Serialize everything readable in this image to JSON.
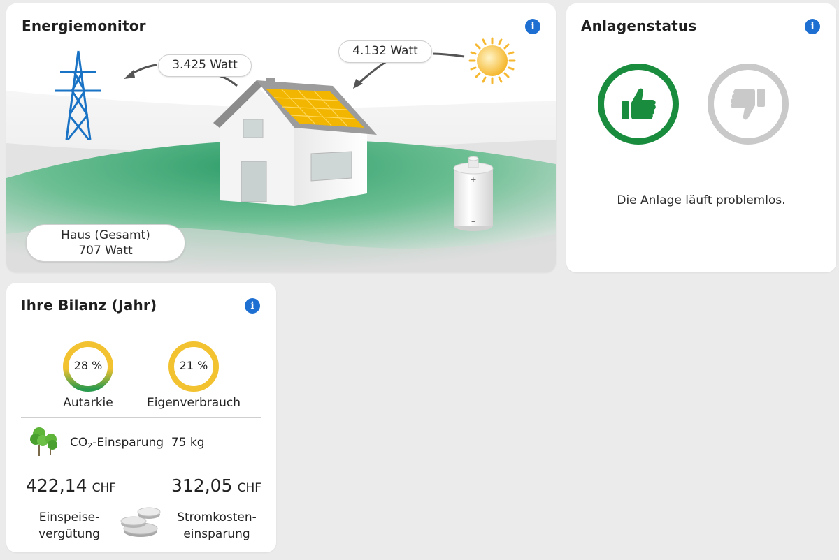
{
  "energy_monitor": {
    "title": "Energiemonitor",
    "grid_feed": "3.425 Watt",
    "solar_production": "4.132 Watt",
    "house_label": "Haus (Gesamt)",
    "house_consumption": "707 Watt"
  },
  "plant_status": {
    "title": "Anlagenstatus",
    "message": "Die Anlage läuft problemlos.",
    "state": "ok",
    "ok_color": "#1a8c3e",
    "inactive_color": "#c9c9c9"
  },
  "balance": {
    "title": "Ihre Bilanz (Jahr)",
    "autarkie": {
      "value_text": "28 %",
      "value": 28,
      "label": "Autarkie"
    },
    "eigenverbrauch": {
      "value_text": "21 %",
      "value": 21,
      "label": "Eigenverbrauch"
    },
    "co2": {
      "prefix": "CO",
      "subscript": "2",
      "suffix": "-Einsparung",
      "amount": "75 kg"
    },
    "einspeise": {
      "amount": "422,14",
      "currency": "CHF",
      "label_line1": "Einspeise-",
      "label_line2": "vergütung"
    },
    "stromkosten": {
      "amount": "312,05",
      "currency": "CHF",
      "label_line1": "Stromkosten-",
      "label_line2": "einsparung"
    }
  },
  "icons": {
    "info": "info-icon",
    "thumbs_up": "thumbs-up-icon",
    "thumbs_down": "thumbs-down-icon",
    "trees": "trees-icon",
    "coins": "coins-icon",
    "sun": "sun-icon",
    "pylon": "power-pylon-icon",
    "battery": "battery-icon",
    "house": "house-icon"
  },
  "colors": {
    "info_blue": "#1d6fd1",
    "landscape_green": "#3aa878",
    "solar_yellow": "#f2b600",
    "pylon_blue": "#1a73c4"
  }
}
